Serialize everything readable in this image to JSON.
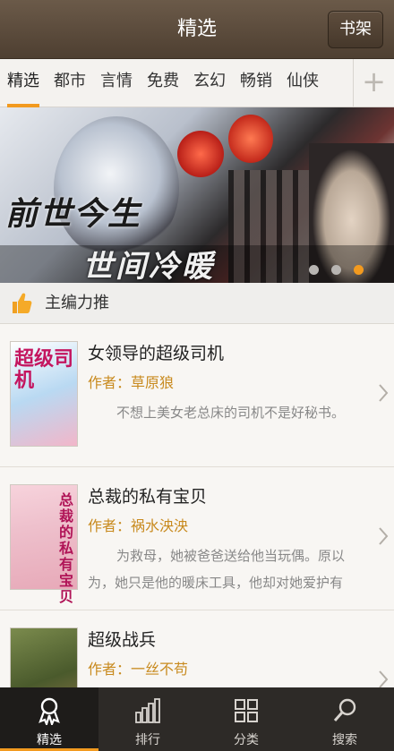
{
  "header": {
    "title": "精选",
    "shelf_label": "书架"
  },
  "tabs": [
    {
      "label": "精选",
      "active": true
    },
    {
      "label": "都市"
    },
    {
      "label": "言情"
    },
    {
      "label": "免费"
    },
    {
      "label": "玄幻"
    },
    {
      "label": "畅销"
    },
    {
      "label": "仙侠"
    }
  ],
  "tab_add_label": "+",
  "banner": {
    "line1": "前世今生",
    "line2": "世间冷暖",
    "slide_count": 3,
    "active_slide": 3
  },
  "section": {
    "title": "主编力推",
    "icon": "thumbs-up-icon"
  },
  "books": [
    {
      "title": "女领导的超级司机",
      "author": "作者：草原狼",
      "description": "不想上美女老总床的司机不是好秘书。",
      "cover_text": "超级司机"
    },
    {
      "title": "总裁的私有宝贝",
      "author": "作者：祸水泱泱",
      "description": "为救母，她被爸爸送给他当玩偶。原以为，她只是他的暖床工具，他却对她爱护有",
      "cover_text": "总裁的私有宝贝"
    },
    {
      "title": "超级战兵",
      "author": "作者：一丝不苟",
      "description": "",
      "cover_text": ""
    }
  ],
  "bottom_nav": [
    {
      "label": "精选",
      "icon": "award-icon",
      "active": true
    },
    {
      "label": "排行",
      "icon": "bar-chart-icon"
    },
    {
      "label": "分类",
      "icon": "grid-icon"
    },
    {
      "label": "搜索",
      "icon": "search-icon"
    }
  ],
  "colors": {
    "accent": "#f29a1f",
    "author": "#c88a1e",
    "topbar": "#5a4a3b",
    "bottom_nav": "#2d2a27"
  }
}
